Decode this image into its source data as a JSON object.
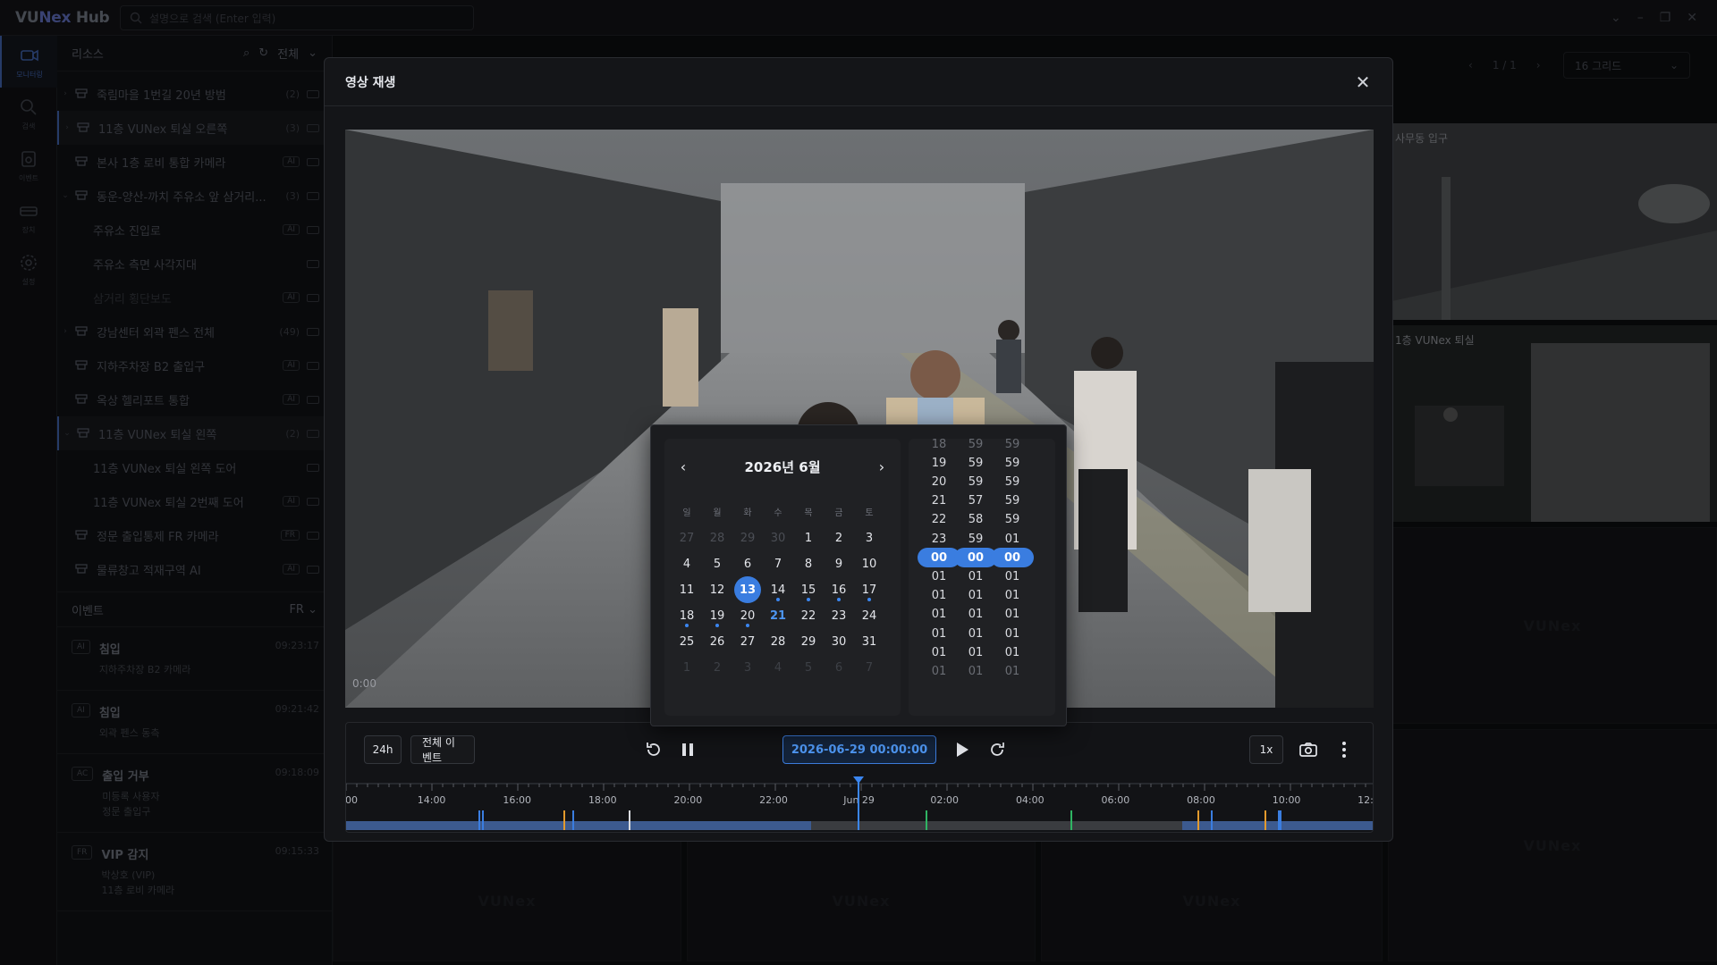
{
  "app": {
    "title_a": "VU",
    "title_b": "Nex",
    "title_c": " Hub",
    "search_placeholder": "설명으로 검색 (Enter 입력)"
  },
  "rail": [
    {
      "label": "모니터링",
      "icon": "video-icon"
    },
    {
      "label": "검색",
      "icon": "search-icon"
    },
    {
      "label": "이벤트",
      "icon": "event-icon"
    },
    {
      "label": "장치",
      "icon": "device-icon"
    },
    {
      "label": "설정",
      "icon": "gear-icon"
    }
  ],
  "sidebar": {
    "resources_title": "리소스",
    "filter": "전체",
    "tree": [
      {
        "label": "죽림마을 1번길 20년 방범",
        "count": "(2)",
        "level": 0,
        "chev": "›"
      },
      {
        "label": "11층 VUNex 퇴실 오른쪽",
        "count": "(3)",
        "level": 0,
        "chev": "›",
        "selected": true
      },
      {
        "label": "본사 1층 로비 통합 카메라",
        "badge": "AI",
        "level": 0
      },
      {
        "label": "동운-양산-까치 주유소 앞 삼거리...",
        "count": "(3)",
        "level": 0,
        "chev": "⌄"
      },
      {
        "label": "주유소 진입로",
        "badge": "AI",
        "level": 1
      },
      {
        "label": "주유소 측면 사각지대",
        "level": 1
      },
      {
        "label": "삼거리 횡단보도",
        "badge": "AI",
        "level": 1,
        "dim": true
      },
      {
        "label": "강남센터 외곽 펜스 전체",
        "count": "(49)",
        "level": 0,
        "chev": "›"
      },
      {
        "label": "지하주차장 B2 출입구",
        "badge": "AI",
        "level": 0
      },
      {
        "label": "옥상 헬리포트 통합",
        "badge": "AI",
        "level": 0
      },
      {
        "label": "11층 VUNex 퇴실 왼쪽",
        "count": "(2)",
        "level": 0,
        "chev": "⌄",
        "selected": true
      },
      {
        "label": "11층 VUNex 퇴실 왼쪽 도어",
        "level": 1
      },
      {
        "label": "11층 VUNex 퇴실 2번째 도어",
        "badge": "AI",
        "level": 1
      },
      {
        "label": "정문 출입통제 FR 카메라",
        "badge": "FR",
        "level": 0
      },
      {
        "label": "물류창고 적재구역 AI",
        "badge": "AI",
        "level": 0
      }
    ],
    "events_title": "이벤트",
    "events_filter": "FR",
    "events": [
      {
        "tag": "AI",
        "title": "침입",
        "sub": [
          "지하주차장 B2 카메라"
        ],
        "time": "09:23:17"
      },
      {
        "tag": "AI",
        "title": "침입",
        "sub": [
          "외곽 펜스 동측"
        ],
        "time": "09:21:42"
      },
      {
        "tag": "AC",
        "title": "출입 거부",
        "sub": [
          "미등록 사용자",
          "정문 출입구"
        ],
        "time": "09:18:09"
      },
      {
        "tag": "FR",
        "title": "VIP 감지",
        "sub": [
          "박상호 (VIP)",
          "11층 로비 카메라"
        ],
        "time": "09:15:33"
      }
    ]
  },
  "main": {
    "page": "1 / 1",
    "grid": "16 그리드",
    "cam1": "사무동 입구",
    "cam2": "1층 VUNex 퇴실",
    "watermark": "VUNex"
  },
  "modal": {
    "title": "영상 재생",
    "video_time": "0:00",
    "btn_24h": "24h",
    "btn_events": "전체 이벤트",
    "datetime": "2026-06-29 00:00:00",
    "speed": "1x",
    "timeline": {
      "labels": [
        "00",
        "14:00",
        "16:00",
        "18:00",
        "20:00",
        "22:00",
        "Jun 29",
        "02:00",
        "04:00",
        "06:00",
        "08:00",
        "10:00",
        "12:"
      ],
      "markers": [
        {
          "color": "#3a7de0"
        },
        {
          "color": "#3a7de0"
        },
        {
          "color": "#e39a2d"
        },
        {
          "color": "#3a7de0"
        },
        {
          "color": "#d9dbe0"
        },
        {
          "color": "#2fb463"
        },
        {
          "color": "#2fb463"
        },
        {
          "color": "#e39a2d"
        },
        {
          "color": "#3a7de0"
        },
        {
          "color": "#e39a2d"
        },
        {
          "color": "#3a7de0"
        }
      ]
    }
  },
  "calendar": {
    "title": "2026년 6월",
    "weekdays": [
      "일",
      "월",
      "화",
      "수",
      "목",
      "금",
      "토"
    ],
    "weeks": [
      [
        {
          "d": "27",
          "m": "muted"
        },
        {
          "d": "28",
          "m": "muted"
        },
        {
          "d": "29",
          "m": "muted"
        },
        {
          "d": "30",
          "m": "muted"
        },
        {
          "d": "1"
        },
        {
          "d": "2"
        },
        {
          "d": "3"
        }
      ],
      [
        {
          "d": "4"
        },
        {
          "d": "5"
        },
        {
          "d": "6"
        },
        {
          "d": "7"
        },
        {
          "d": "8"
        },
        {
          "d": "9"
        },
        {
          "d": "10"
        }
      ],
      [
        {
          "d": "11"
        },
        {
          "d": "12"
        },
        {
          "d": "13",
          "m": "sel"
        },
        {
          "d": "14",
          "dot": true
        },
        {
          "d": "15",
          "dot": true
        },
        {
          "d": "16",
          "dot": true
        },
        {
          "d": "17",
          "dot": true
        }
      ],
      [
        {
          "d": "18",
          "dot": true
        },
        {
          "d": "19",
          "dot": true
        },
        {
          "d": "20",
          "dot": true
        },
        {
          "d": "21",
          "m": "today"
        },
        {
          "d": "22"
        },
        {
          "d": "23"
        },
        {
          "d": "24"
        }
      ],
      [
        {
          "d": "25"
        },
        {
          "d": "26"
        },
        {
          "d": "27"
        },
        {
          "d": "28"
        },
        {
          "d": "29"
        },
        {
          "d": "30"
        },
        {
          "d": "31"
        }
      ],
      [
        {
          "d": "1",
          "m": "faint"
        },
        {
          "d": "2",
          "m": "faint"
        },
        {
          "d": "3",
          "m": "faint"
        },
        {
          "d": "4",
          "m": "faint"
        },
        {
          "d": "5",
          "m": "faint"
        },
        {
          "d": "6",
          "m": "faint"
        },
        {
          "d": "7",
          "m": "faint"
        }
      ]
    ],
    "time_columns": [
      [
        "18",
        "19",
        "20",
        "21",
        "22",
        "23",
        "00",
        "01",
        "01",
        "01",
        "01",
        "01",
        "01"
      ],
      [
        "59",
        "59",
        "59",
        "57",
        "58",
        "59",
        "00",
        "01",
        "01",
        "01",
        "01",
        "01",
        "01"
      ],
      [
        "59",
        "59",
        "59",
        "59",
        "59",
        "01",
        "00",
        "01",
        "01",
        "01",
        "01",
        "01",
        "01"
      ]
    ]
  }
}
